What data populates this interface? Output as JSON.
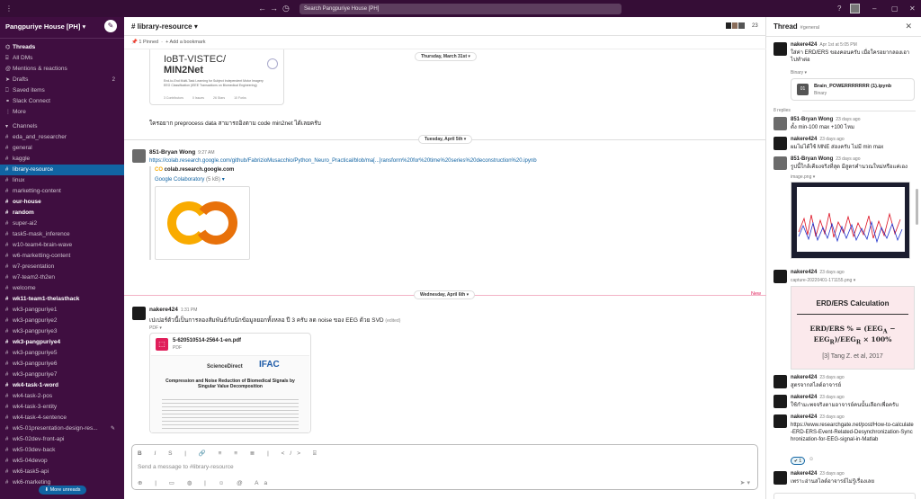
{
  "topbar": {
    "search_placeholder": "Search Pangpuriye House [PH]",
    "back_icon": "arrow-left-icon",
    "forward_icon": "arrow-right-icon",
    "history_icon": "clock-icon"
  },
  "workspace": {
    "name": "Pangpuriye House [PH]",
    "chevron": "▾"
  },
  "nav": [
    {
      "label": "Threads",
      "icon": "threads-icon",
      "bold": true
    },
    {
      "label": "All DMs",
      "icon": "dm-icon"
    },
    {
      "label": "Mentions & reactions",
      "icon": "at-icon"
    },
    {
      "label": "Drafts",
      "icon": "drafts-icon",
      "count": "2"
    },
    {
      "label": "Saved items",
      "icon": "bookmark-icon"
    },
    {
      "label": "Slack Connect",
      "icon": "connect-icon"
    },
    {
      "label": "More",
      "icon": "more-icon"
    }
  ],
  "channels_header": "Channels",
  "channels": [
    {
      "label": "eda_and_researcher"
    },
    {
      "label": "general"
    },
    {
      "label": "kaggle"
    },
    {
      "label": "library-resource",
      "active": true
    },
    {
      "label": "linux"
    },
    {
      "label": "marketting-content"
    },
    {
      "label": "our-house",
      "bold": true
    },
    {
      "label": "random",
      "bold": true
    },
    {
      "label": "super-ai2"
    },
    {
      "label": "task5-mask_inference"
    },
    {
      "label": "w10-team4-brain-wave"
    },
    {
      "label": "w6-marketting-content"
    },
    {
      "label": "w7-presentation"
    },
    {
      "label": "w7-team2-th2en"
    },
    {
      "label": "welcome"
    },
    {
      "label": "wk11-team1-thelasthack",
      "bold": true
    },
    {
      "label": "wk3-pangpuriye1"
    },
    {
      "label": "wk3-pangpuriye2"
    },
    {
      "label": "wk3-pangpuriye3"
    },
    {
      "label": "wk3-pangpuriye4",
      "bold": true
    },
    {
      "label": "wk3-pangpuriye5"
    },
    {
      "label": "wk3-pangpuriye6"
    },
    {
      "label": "wk3-pangpuriye7"
    },
    {
      "label": "wk4-task-1-word",
      "bold": true
    },
    {
      "label": "wk4-task-2-pos"
    },
    {
      "label": "wk4-task-3-entity"
    },
    {
      "label": "wk4-task-4-sentence"
    },
    {
      "label": "wk5-01presentation-design-res..."
    },
    {
      "label": "wk5-02dev-front-api"
    },
    {
      "label": "wk5-03dev-back"
    },
    {
      "label": "wk5-04devop"
    },
    {
      "label": "wk6-task5-api"
    },
    {
      "label": "wk6-marketing"
    }
  ],
  "more_unreads": "More unreads",
  "channel": {
    "title": "# library-resource",
    "member_count": "23",
    "pinned": "1 Pinned",
    "add_bookmark": "+ Add a bookmark"
  },
  "preview_card": {
    "title_line1": "IoBT-VISTEC/",
    "title_line2": "MIN2Net",
    "desc": "End-to-End Multi-Task Learning for Subject Independent Motor Imagery EEG Classification (IEEE Transactions on Biomedical Engineering)",
    "stats": [
      "3 Contributors",
      "0 Issues",
      "26 Stars",
      "10 Forks"
    ]
  },
  "messages": {
    "date1": "Thursday, March 31st",
    "prev_text": "ใครอยาก preprocess data สามารถอิงตาม code min2net ได้เลยครับ",
    "date2": "Tuesday, April 5th",
    "m1_name": "851-Bryan Wong",
    "m1_time": "9:27 AM",
    "m1_link": "https://colab.research.google.com/github/FabrizioMusacchio/Python_Neuro_Practical/blob/ma[...]ransform%20for%20time%20series%20deconstruction%20.ipynb",
    "m1_site": "colab.research.google.com",
    "m1_title": "Google Colaboratory",
    "m1_size": "(5 kB)",
    "date3": "Wednesday, April 6th",
    "new_label": "New",
    "m2_name": "nakere424",
    "m2_time": "1:31 PM",
    "m2_text": "เปเปอร์ตัวนี้เป็นการลองสัมพันธ์กับนักข้อมูลยอกทั้งหลอ ปี 3 ครับ ลด noise ของ EEG ด้วย SVD",
    "m2_edited": "(edited)",
    "pdf_label": "PDF",
    "pdf_name": "5-620510514-2564-1-en.pdf",
    "pdf_type": "PDF",
    "pdf_journal": "ScienceDirect",
    "pdf_title": "Compression and Noise Reduction of Biomedical Signals by Singular Value Decomposition"
  },
  "composer": {
    "placeholder": "Send a message to #library-resource"
  },
  "thread": {
    "title": "Thread",
    "channel": "#general",
    "items": [
      {
        "name": "nakere424",
        "time": "Apr 1st at 5:05 PM",
        "text": "ใส่ค่า ERD/ERS ของคอนครับ เมื่อใครอยากลองเอาไปทำต่อ",
        "meta": "Binary ▾"
      },
      {
        "file_name": "Brain_POWERRRRRRR (1).ipynb",
        "file_type": "Binary"
      },
      {
        "replies": "8 replies"
      },
      {
        "name": "851-Bryan Wong",
        "time": "23 days ago",
        "text": "ตั้ง min-100 max +100 ไหม"
      },
      {
        "name": "nakere424",
        "time": "23 days ago",
        "text": "ผมไม่ได้ใช้ MNE ส่องครับ ไม่มี min max"
      },
      {
        "name": "851-Bryan Wong",
        "time": "23 days ago",
        "text": "รูปนี้ใกล้เคียงจริงที่สุด มีสูตรคำนวณใหม่หรือแค่เอง",
        "meta": "image.png ▾"
      },
      {
        "name": "nakere424",
        "time": "23 days ago",
        "meta": "capture-20220401-171155.png ▾"
      },
      {
        "erd_title": "ERD/ERS Calculation",
        "erd_cite": "[3] Tang Z. et al, 2017"
      },
      {
        "name": "nakere424",
        "time": "23 days ago",
        "text": "สูตรจากสไลด์อาจารย์"
      },
      {
        "name": "nakere424",
        "time": "23 days ago",
        "text": "ใช้กำมะพจจริงตามอาจารย์คนนั้นเลือกเพื่อครับ"
      },
      {
        "name": "nakere424",
        "time": "23 days ago",
        "link": "https://www.researchgate.net/post/How-to-calculate-ERD-ERS-Event-Related-Desynchronization-Synchronization-for-EEG-signal-in-Matlab",
        "reaction": "1"
      },
      {
        "name": "nakere424",
        "time": "23 days ago",
        "text": "เพราะอ่านสไลด์อาจารย์ไม่รู้เรื่องเลย"
      }
    ]
  },
  "colors": {
    "topbar": "#350d36",
    "sidebar": "#3f0e40",
    "active": "#1164a3",
    "link": "#1264a3",
    "new": "#e01e5a",
    "colab_orange": "#f9ab00"
  }
}
